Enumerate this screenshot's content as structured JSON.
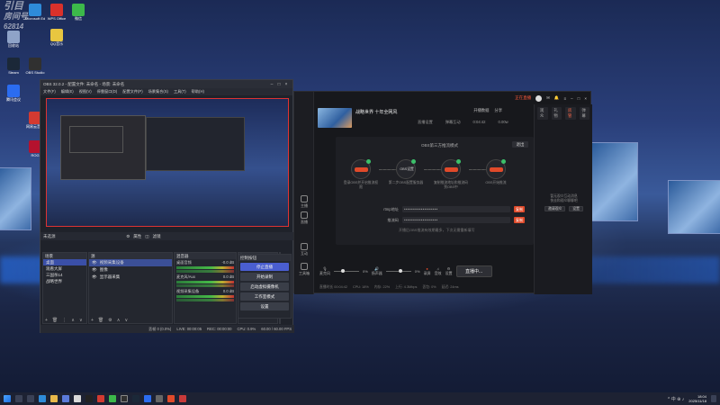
{
  "desktop": {
    "watermark": [
      "引目",
      "房间号",
      "62814"
    ],
    "icons": [
      {
        "label": "回收站",
        "color": "#8fa3c8"
      },
      {
        "label": "Microsoft Edge",
        "color": "#2e8bd9"
      },
      {
        "label": "WPS Office",
        "color": "#d9312b"
      },
      {
        "label": "微信",
        "color": "#3cb84a"
      },
      {
        "label": "QQ音乐",
        "color": "#e8c640"
      },
      {
        "label": "Steam",
        "color": "#1b2838"
      },
      {
        "label": "OBS Studio",
        "color": "#303030"
      },
      {
        "label": "腾讯会议",
        "color": "#2b6cf0"
      },
      {
        "label": "网易云音乐",
        "color": "#d33a31"
      },
      {
        "label": "ROG",
        "color": "#b5122e"
      }
    ]
  },
  "obs": {
    "title": "OBS 32.0.2 - 配置文件: 未命名 - 场景: 未命名",
    "menu": [
      "文件(F)",
      "编辑(E)",
      "视图(V)",
      "停靠窗口(D)",
      "配置文件(P)",
      "场景集合(S)",
      "工具(T)",
      "帮助(H)"
    ],
    "tabs": [
      "未选源",
      "属性",
      "滤镜"
    ],
    "scenes_title": "场景",
    "scenes": [
      "桌面",
      "观看大屏",
      "三国杀14",
      "战略世界"
    ],
    "sources_title": "源",
    "sources": [
      "视频采集设备",
      "图像",
      "显示器采集"
    ],
    "mixer_title": "混音器",
    "mixer": [
      {
        "name": "桌面音频",
        "db": "-0.0 dB"
      },
      {
        "name": "麦克风/Aux",
        "db": "0.0 dB"
      },
      {
        "name": "视频采集设备",
        "db": "0.0 dB"
      }
    ],
    "transitions_title": "转场动画",
    "transition": "淡入淡出",
    "duration_label": "时长",
    "duration": "300 ms",
    "controls_title": "控制按钮",
    "controls": [
      "停止直播",
      "开始录制",
      "启动虚拟摄像机",
      "工作室模式",
      "设置"
    ],
    "statusbar": [
      "丢帧 0 (0.0%)",
      "LIVE: 00:00:05",
      "REC: 00:00:00",
      "CPU: 0.9%",
      "60.00 / 60.00 FPS"
    ]
  },
  "app": {
    "live_label": "正在直播",
    "topbar": [
      "开播数据",
      "分享"
    ],
    "room_title": "战略世界 十年全网风",
    "room_meta": [
      "直播设置",
      "弹幕互动",
      "0:04:42",
      "0.00w"
    ],
    "setup_title": "OBS第三方推流模式",
    "close_label": "退出",
    "steps": [
      {
        "label": "",
        "desc": "登录OBS并开启推流权限"
      },
      {
        "label": "OBS设置",
        "desc": "第二步OBS配置服务器"
      },
      {
        "label": "直播服务",
        "desc": "复制推流地址和推流码到OBS中"
      },
      {
        "label": "",
        "desc": "OBS开始推流"
      }
    ],
    "fields": [
      {
        "label": "rtmp地址",
        "value": "••••••••••••••••••••",
        "btn": "复制"
      },
      {
        "label": "推流码",
        "value": "••••••••••••••••••••",
        "btn": "复制"
      }
    ],
    "setup_hint": "开播后OBS推流有效期最多，下次无需重新填写",
    "side_nav": [
      "主播",
      "直播",
      "互动",
      "工具箱"
    ],
    "controls": [
      "麦克风",
      "扬声器",
      "录屏",
      "音效",
      "设置"
    ],
    "mic_percent": "0%",
    "speaker_percent": "0%",
    "start_label": "直播中...",
    "status": [
      "直播时长 00:04:42",
      "CPU: 18%",
      "内存: 22%",
      "上行: 4.3Mbps",
      "丢包: 0%",
      "延迟: 24ms"
    ],
    "right_tabs": [
      "观众",
      "礼物",
      "房管",
      "弹幕"
    ],
    "right_msg": "暂无观众互动消息\n快去和观众聊聊吧",
    "right_btns": [
      "邀请观众",
      "设置"
    ]
  },
  "taskbar": {
    "time": "18:04",
    "date": "2025/11/18",
    "tray": "^ 中 ⊕ ♪"
  }
}
